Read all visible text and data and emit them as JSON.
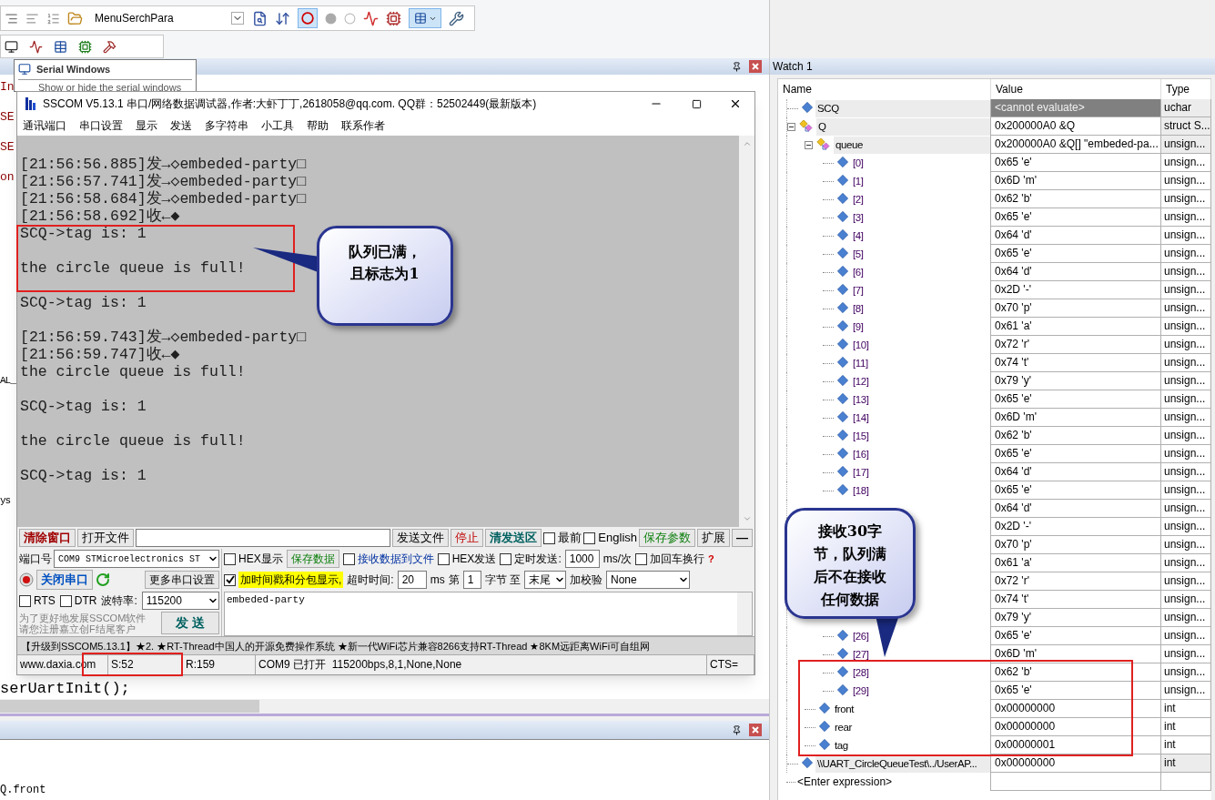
{
  "ide": {
    "toolbar_combo": "MenuSerchPara",
    "tooltip": {
      "title": "Serial Windows",
      "text": "Show or hide the serial windows"
    },
    "editor_upper": [
      "In",
      "SE",
      "SE",
      "on"
    ],
    "editor_lower": [
      "AL_",
      "ys"
    ],
    "editor_last_line": "serUartInit();",
    "output_lines": [
      "Q.front"
    ]
  },
  "sscom": {
    "title": "SSCOM V5.13.1 串口/网络数据调试器,作者:大虾丁丁,2618058@qq.com. QQ群：52502449(最新版本)",
    "menu": [
      "通讯端口",
      "串口设置",
      "显示",
      "发送",
      "多字符串",
      "小工具",
      "帮助",
      "联系作者"
    ],
    "terminal_blocks": [
      [
        "[21:56:56.885]发→◇embeded-party□",
        "[21:56:57.741]发→◇embeded-party□",
        "[21:56:58.684]发→◇embeded-party□",
        "[21:56:58.692]收←◆",
        "SCQ->tag is: 1"
      ],
      [
        "the circle queue is full!"
      ],
      [
        "SCQ->tag is: 1"
      ],
      [
        "[21:56:59.743]发→◇embeded-party□",
        "[21:56:59.747]收←◆",
        "the circle queue is full!"
      ],
      [
        "SCQ->tag is: 1"
      ],
      [
        "the circle queue is full!"
      ],
      [
        "SCQ->tag is: 1"
      ]
    ],
    "send_bar": {
      "clear_button": "清除窗口",
      "open_file_button": "打开文件",
      "send_file_button": "发送文件",
      "stop_button": "停止",
      "clear_send_button": "清发送区",
      "topmost": {
        "label": "最前",
        "checked": false
      },
      "english": {
        "label": "English",
        "checked": false
      },
      "save_params_button": "保存参数",
      "expand_button": "扩展",
      "minus_button": "—"
    },
    "port": {
      "label": "端口号",
      "value": "COM9 STMicroelectronics ST",
      "close_port_button": "关闭串口",
      "more_settings_button": "更多串口设置",
      "rts": {
        "label": "RTS",
        "checked": false
      },
      "dtr": {
        "label": "DTR",
        "checked": false
      },
      "baud_label": "波特率:",
      "baud_value": "115200",
      "promo": [
        "为了更好地发展SSCOM软件",
        "请您注册嘉立创F结尾客户"
      ],
      "send_button": "发 送"
    },
    "options": {
      "hex_display": {
        "label": "HEX显示",
        "checked": false
      },
      "save_data_button": "保存数据",
      "receive_to_file": {
        "label": "接收数据到文件",
        "checked": false
      },
      "hex_send": {
        "label": "HEX发送",
        "checked": false
      },
      "timed_send": {
        "label": "定时发送:",
        "checked": false
      },
      "interval": "1000",
      "interval_unit": "ms/次",
      "append_newline": {
        "label": "加回车换行",
        "checked": false
      },
      "help_mark": "?",
      "timestamp": {
        "label": "加时间戳和分包显示,",
        "checked": true
      },
      "timeout_label": "超时时间:",
      "timeout": "20",
      "timeout_unit": "ms",
      "byte_from_label": "第",
      "byte_from": "1",
      "byte_to_label": "字节 至",
      "byte_to": "末尾",
      "checksum_label": "加校验",
      "checksum": "None"
    },
    "send_text": "embeded-party",
    "marquee": "【升级到SSCOM5.13.1】★2. ★RT-Thread中国人的开源免费操作系统 ★新一代WiFi芯片兼容8266支持RT-Thread ★8KM远距离WiFi可自组网",
    "status": [
      "www.daxia.com",
      "S:52",
      "R:159",
      "COM9 已打开  115200bps,8,1,None,None",
      "CTS="
    ]
  },
  "callouts": [
    {
      "lines": [
        "队列已满，",
        "且标志为1"
      ]
    },
    {
      "lines": [
        "接收30字",
        "节，队列满",
        "后不在接收",
        "任何数据"
      ]
    }
  ],
  "watch": {
    "title": "Watch 1",
    "columns": [
      "Name",
      "Value",
      "Type"
    ],
    "rows": [
      {
        "name": "SCQ",
        "value": "<cannot evaluate>",
        "type": "uchar",
        "kind": "scalar",
        "error": true
      },
      {
        "name": "Q",
        "value": "0x200000A0 &Q",
        "type": "struct S...",
        "kind": "struct",
        "error": false,
        "expanded": true,
        "children": [
          {
            "name": "queue",
            "value": "0x200000A0 &Q[] \"embeded-pa...",
            "type": "unsign...",
            "kind": "struct",
            "error": false,
            "expanded": true,
            "children": [
              {
                "name": "[0]",
                "value": "0x65 'e'",
                "type": "unsign...",
                "kind": "scalar",
                "error": false
              },
              {
                "name": "[1]",
                "value": "0x6D 'm'",
                "type": "unsign...",
                "kind": "scalar",
                "error": false
              },
              {
                "name": "[2]",
                "value": "0x62 'b'",
                "type": "unsign...",
                "kind": "scalar",
                "error": false
              },
              {
                "name": "[3]",
                "value": "0x65 'e'",
                "type": "unsign...",
                "kind": "scalar",
                "error": false
              },
              {
                "name": "[4]",
                "value": "0x64 'd'",
                "type": "unsign...",
                "kind": "scalar",
                "error": false
              },
              {
                "name": "[5]",
                "value": "0x65 'e'",
                "type": "unsign...",
                "kind": "scalar",
                "error": false
              },
              {
                "name": "[6]",
                "value": "0x64 'd'",
                "type": "unsign...",
                "kind": "scalar",
                "error": false
              },
              {
                "name": "[7]",
                "value": "0x2D '-'",
                "type": "unsign...",
                "kind": "scalar",
                "error": false
              },
              {
                "name": "[8]",
                "value": "0x70 'p'",
                "type": "unsign...",
                "kind": "scalar",
                "error": false
              },
              {
                "name": "[9]",
                "value": "0x61 'a'",
                "type": "unsign...",
                "kind": "scalar",
                "error": false
              },
              {
                "name": "[10]",
                "value": "0x72 'r'",
                "type": "unsign...",
                "kind": "scalar",
                "error": false
              },
              {
                "name": "[11]",
                "value": "0x74 't'",
                "type": "unsign...",
                "kind": "scalar",
                "error": false
              },
              {
                "name": "[12]",
                "value": "0x79 'y'",
                "type": "unsign...",
                "kind": "scalar",
                "error": false
              },
              {
                "name": "[13]",
                "value": "0x65 'e'",
                "type": "unsign...",
                "kind": "scalar",
                "error": false
              },
              {
                "name": "[14]",
                "value": "0x6D 'm'",
                "type": "unsign...",
                "kind": "scalar",
                "error": false
              },
              {
                "name": "[15]",
                "value": "0x62 'b'",
                "type": "unsign...",
                "kind": "scalar",
                "error": false
              },
              {
                "name": "[16]",
                "value": "0x65 'e'",
                "type": "unsign...",
                "kind": "scalar",
                "error": false
              },
              {
                "name": "[17]",
                "value": "0x64 'd'",
                "type": "unsign...",
                "kind": "scalar",
                "error": false
              },
              {
                "name": "[18]",
                "value": "0x65 'e'",
                "type": "unsign...",
                "kind": "scalar",
                "error": false
              },
              {
                "value": "0x64 'd'",
                "type": "unsign...",
                "kind": "scalar",
                "error": false
              },
              {
                "value": "0x2D '-'",
                "type": "unsign...",
                "kind": "scalar",
                "error": false
              },
              {
                "value": "0x70 'p'",
                "type": "unsign...",
                "kind": "scalar",
                "error": false
              },
              {
                "value": "0x61 'a'",
                "type": "unsign...",
                "kind": "scalar",
                "error": false
              },
              {
                "value": "0x72 'r'",
                "type": "unsign...",
                "kind": "scalar",
                "error": false
              },
              {
                "value": "0x74 't'",
                "type": "unsign...",
                "kind": "scalar",
                "error": false
              },
              {
                "value": "0x79 'y'",
                "type": "unsign...",
                "kind": "scalar",
                "error": false
              },
              {
                "name": "[26]",
                "value": "0x65 'e'",
                "type": "unsign...",
                "kind": "scalar",
                "error": false
              },
              {
                "name": "[27]",
                "value": "0x6D 'm'",
                "type": "unsign...",
                "kind": "scalar",
                "error": false
              },
              {
                "name": "[28]",
                "value": "0x62 'b'",
                "type": "unsign...",
                "kind": "scalar",
                "error": false
              },
              {
                "name": "[29]",
                "value": "0x65 'e'",
                "type": "unsign...",
                "kind": "scalar",
                "error": false
              }
            ]
          },
          {
            "name": "front",
            "value": "0x00000000",
            "type": "int",
            "kind": "scalar",
            "error": false
          },
          {
            "name": "rear",
            "value": "0x00000000",
            "type": "int",
            "kind": "scalar",
            "error": false
          },
          {
            "name": "tag",
            "value": "0x00000001",
            "type": "int",
            "kind": "scalar",
            "error": false
          }
        ]
      },
      {
        "name": "\\\\UART_CircleQueueTest\\../UserAP...",
        "value": "0x00000000",
        "type": "int",
        "kind": "scalar",
        "error": false
      }
    ],
    "enter_expression": "<Enter expression>"
  }
}
